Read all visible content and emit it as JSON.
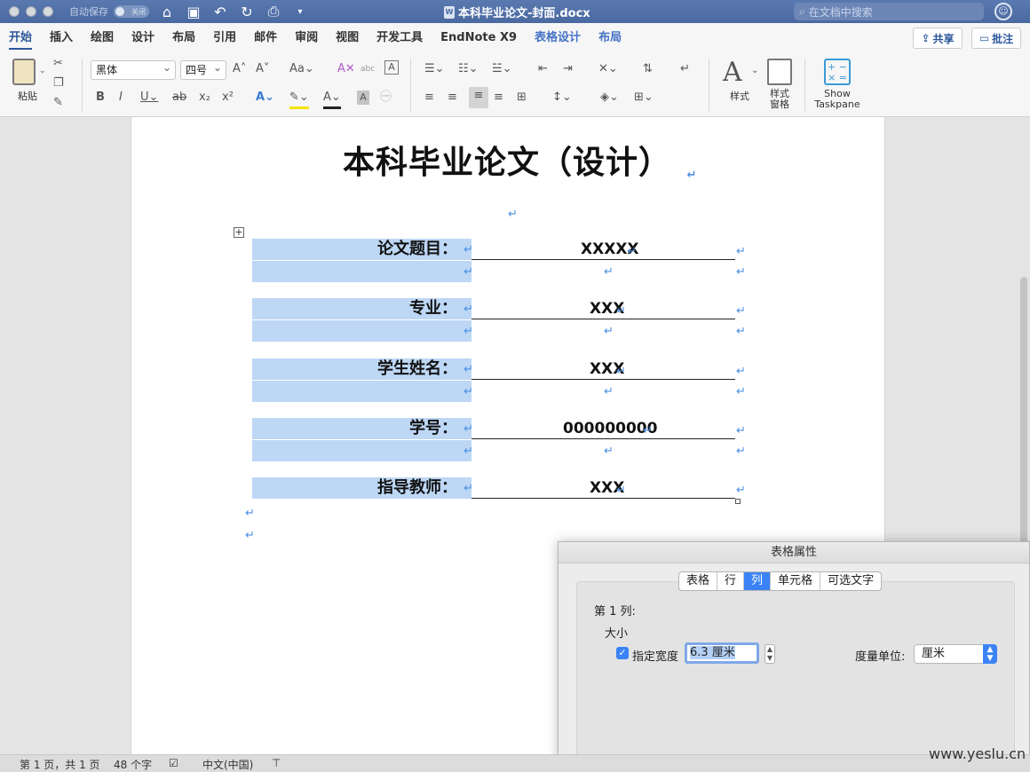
{
  "window": {
    "autosave_label": "自动保存",
    "autosave_state": "关闭",
    "title": "本科毕业论文-封面.docx",
    "search_placeholder": "在文档中搜索"
  },
  "menu": {
    "tabs": [
      "开始",
      "插入",
      "绘图",
      "设计",
      "布局",
      "引用",
      "邮件",
      "审阅",
      "视图",
      "开发工具",
      "EndNote X9",
      "表格设计",
      "布局"
    ],
    "active_tab": "开始",
    "share_label": "共享",
    "comment_label": "批注"
  },
  "ribbon": {
    "paste_label": "粘贴",
    "font_name": "黑体",
    "font_size": "四号",
    "styles_label": "样式",
    "styles_pane_label": "样式窗格",
    "taskpane_label": "Show Taskpane"
  },
  "document": {
    "title": "本科毕业论文（设计）",
    "rows": [
      {
        "label": "论文题目：",
        "value": "XXXXX"
      },
      {
        "label": "专业：",
        "value": "XXX"
      },
      {
        "label": "学生姓名：",
        "value": "XXX"
      },
      {
        "label": "学号：",
        "value": "000000000"
      },
      {
        "label": "指导教师：",
        "value": "XXX"
      }
    ]
  },
  "dialog": {
    "title": "表格属性",
    "tabs": [
      "表格",
      "行",
      "列",
      "单元格",
      "可选文字"
    ],
    "active_tab": "列",
    "column_label": "第 1 列:",
    "size_heading": "大小",
    "specify_width_label": "指定宽度",
    "specify_width_checked": true,
    "width_value": "6.3 厘米",
    "unit_label": "度量单位:",
    "unit_value": "厘米"
  },
  "status": {
    "page_info": "第 1 页，共 1 页",
    "word_count": "48 个字",
    "language": "中文(中国)"
  },
  "watermark": "www.yeslu.cn",
  "colors": {
    "titlebar": "#4a69a0",
    "accent": "#2b579a",
    "cell_highlight": "#bdd7f5",
    "dialog_active": "#3b82f6"
  }
}
